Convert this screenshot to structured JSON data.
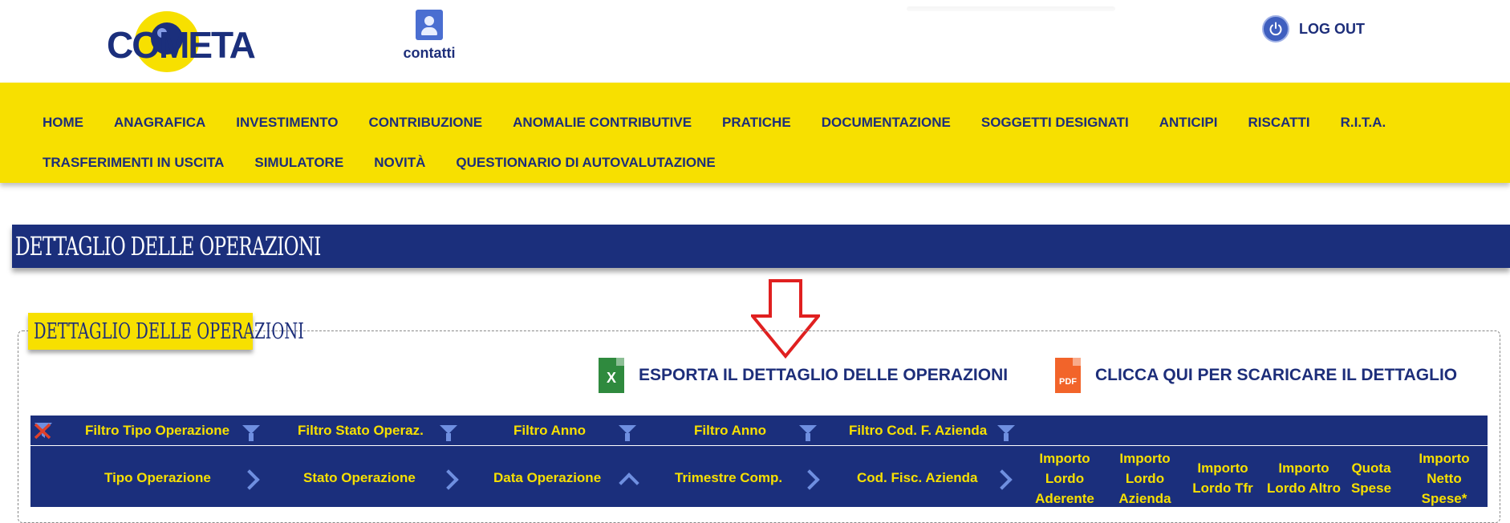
{
  "header": {
    "logo_text": "COMETA",
    "contacts_label": "contatti",
    "logout_label": "LOG OUT"
  },
  "nav": {
    "row1": [
      "HOME",
      "ANAGRAFICA",
      "INVESTIMENTO",
      "CONTRIBUZIONE",
      "ANOMALIE CONTRIBUTIVE",
      "PRATICHE",
      "DOCUMENTAZIONE",
      "SOGGETTI DESIGNATI",
      "ANTICIPI",
      "RISCATTI",
      "R.I.T.A."
    ],
    "row2": [
      "TRASFERIMENTI IN USCITA",
      "SIMULATORE",
      "NOVITÀ",
      "QUESTIONARIO DI AUTOVALUTAZIONE"
    ]
  },
  "page": {
    "title": "DETTAGLIO DELLE OPERAZIONI",
    "section_title": "DETTAGLIO DELLE OPERAZIONI"
  },
  "actions": {
    "export_excel_label": "ESPORTA IL DETTAGLIO DELLE OPERAZIONI",
    "excel_icon_letter": "X",
    "download_pdf_label": "CLICCA QUI PER SCARICARE IL DETTAGLIO",
    "pdf_icon_text": "PDF"
  },
  "table": {
    "filters": [
      "Filtro Tipo Operazione",
      "Filtro Stato Operaz.",
      "Filtro Anno",
      "Filtro Anno",
      "Filtro Cod. F. Azienda"
    ],
    "columns": [
      "Tipo Operazione",
      "Stato Operazione",
      "Data Operazione",
      "Trimestre Comp.",
      "Cod. Fisc. Azienda",
      "Importo Lordo Aderente",
      "Importo Lordo Azienda",
      "Importo Lordo Tfr",
      "Importo Lordo Altro",
      "Quota Spese",
      "Importo Netto Spese*"
    ]
  },
  "colors": {
    "brand_navy": "#1b2f7c",
    "brand_yellow": "#f7e000",
    "accent_blue": "#6f8fe0"
  }
}
